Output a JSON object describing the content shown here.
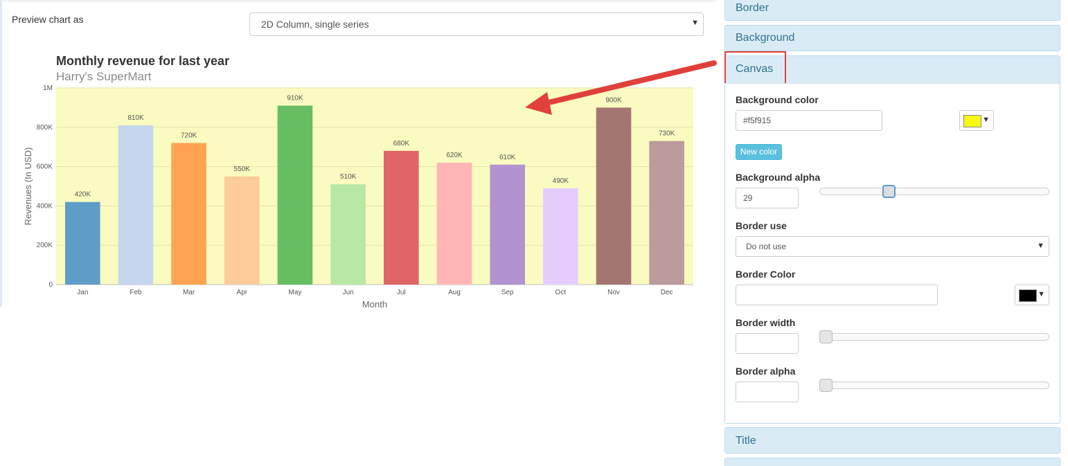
{
  "preview": {
    "label": "Preview chart as",
    "select_value": "2D Column, single series"
  },
  "chart_data": {
    "type": "bar",
    "title": "Monthly revenue for last year",
    "subtitle": "Harry's SuperMart",
    "xlabel": "Month",
    "ylabel": "Revenues (In USD)",
    "categories": [
      "Jan",
      "Feb",
      "Mar",
      "Apr",
      "May",
      "Jun",
      "Jul",
      "Aug",
      "Sep",
      "Oct",
      "Nov",
      "Dec"
    ],
    "values": [
      420000,
      810000,
      720000,
      550000,
      910000,
      510000,
      680000,
      620000,
      610000,
      490000,
      900000,
      730000
    ],
    "value_labels": [
      "420K",
      "810K",
      "720K",
      "550K",
      "910K",
      "510K",
      "680K",
      "620K",
      "610K",
      "490K",
      "900K",
      "730K"
    ],
    "bar_colors": [
      "#5f9dc9",
      "#c5d7ee",
      "#fea352",
      "#fecb9a",
      "#67be62",
      "#b8e7a6",
      "#e06566",
      "#feb5b5",
      "#b293cf",
      "#e6cdfd",
      "#a57571",
      "#bb9b9b"
    ],
    "ylim": [
      0,
      1000000
    ],
    "yticks": [
      0,
      200000,
      400000,
      600000,
      800000,
      1000000
    ],
    "ytick_labels": [
      "0",
      "200K",
      "400K",
      "600K",
      "800K",
      "1M"
    ],
    "grid": true,
    "canvas_color": "#fafbc0"
  },
  "panel": {
    "sections": {
      "border": "Border",
      "background": "Background",
      "canvas": "Canvas",
      "title": "Title"
    },
    "canvas": {
      "bg_color_label": "Background color",
      "bg_color_value": "#f5f915",
      "bg_swatch_color": "#f5f915",
      "new_color_label": "New color",
      "bg_alpha_label": "Background alpha",
      "bg_alpha_value": "29",
      "bg_alpha_slider": 0.29,
      "border_use_label": "Border use",
      "border_use_value": "Do not use",
      "border_color_label": "Border Color",
      "border_color_value": "",
      "border_swatch_color": "#000000",
      "border_width_label": "Border width",
      "border_width_value": "",
      "border_width_slider": 0,
      "border_alpha_label": "Border alpha",
      "border_alpha_value": "",
      "border_alpha_slider": 0
    }
  },
  "annotation": {
    "arrow_color": "#e0403a"
  }
}
